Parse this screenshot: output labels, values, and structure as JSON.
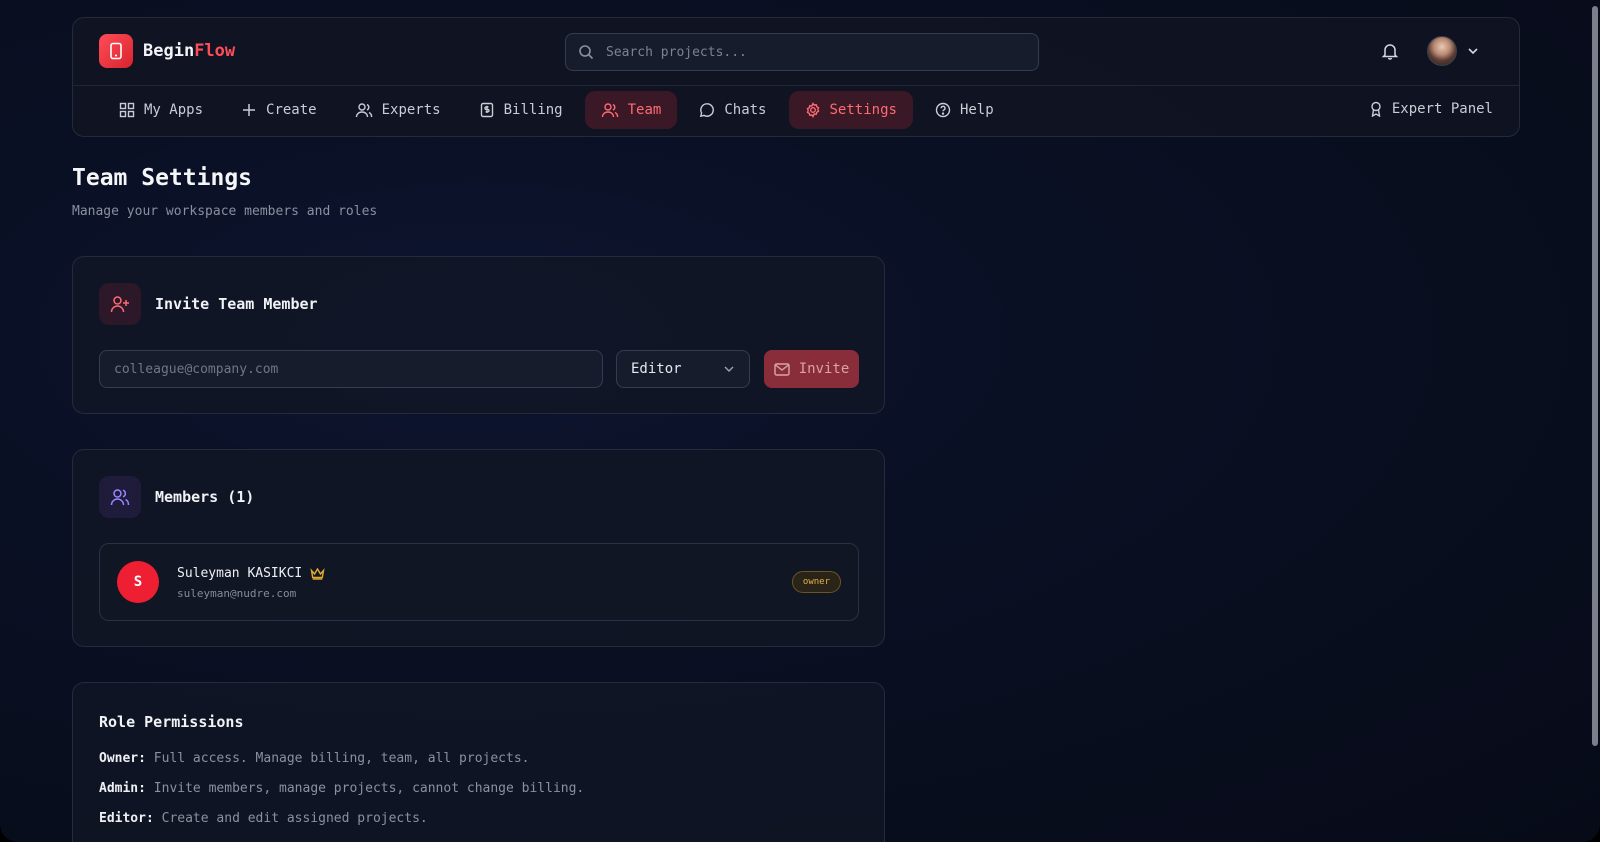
{
  "brand": {
    "name_part1": "Begin",
    "name_part2": "Flow",
    "accent_color": "#ff4d57"
  },
  "search": {
    "placeholder": "Search projects..."
  },
  "nav": {
    "items": [
      {
        "label": "My Apps",
        "icon": "grid-icon",
        "active": false
      },
      {
        "label": "Create",
        "icon": "plus-icon",
        "active": false
      },
      {
        "label": "Experts",
        "icon": "users-icon",
        "active": false
      },
      {
        "label": "Billing",
        "icon": "receipt-icon",
        "active": false
      },
      {
        "label": "Team",
        "icon": "user-icon",
        "active": true
      },
      {
        "label": "Chats",
        "icon": "chat-bubble-icon",
        "active": false
      },
      {
        "label": "Settings",
        "icon": "gear-icon",
        "active": true
      },
      {
        "label": "Help",
        "icon": "help-circle-icon",
        "active": false
      }
    ],
    "expert_panel": "Expert Panel"
  },
  "page": {
    "title": "Team Settings",
    "subtitle": "Manage your workspace members and roles"
  },
  "invite": {
    "title": "Invite Team Member",
    "email_placeholder": "colleague@company.com",
    "role_selected": "Editor",
    "button_label": "Invite"
  },
  "members": {
    "title": "Members (1)",
    "list": [
      {
        "initial": "S",
        "name": "Suleyman KASIKCI",
        "email": "suleyman@nudre.com",
        "role_badge": "owner"
      }
    ]
  },
  "permissions": {
    "title": "Role Permissions",
    "roles": [
      {
        "role": "Owner:",
        "desc": "Full access. Manage billing, team, all projects."
      },
      {
        "role": "Admin:",
        "desc": "Invite members, manage projects, cannot change billing."
      },
      {
        "role": "Editor:",
        "desc": "Create and edit assigned projects."
      }
    ]
  }
}
